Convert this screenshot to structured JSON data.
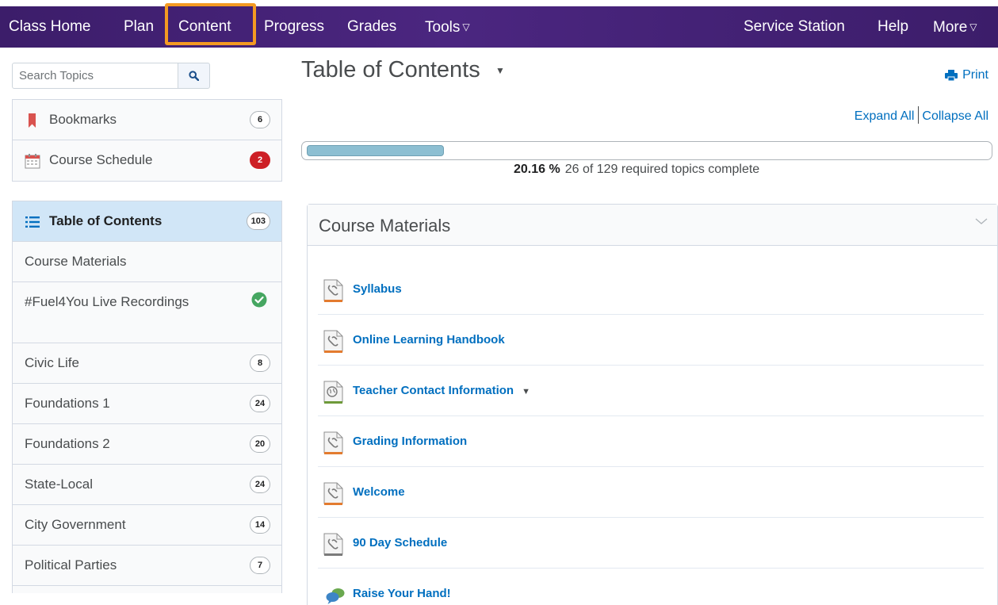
{
  "navbar": {
    "items": [
      {
        "label": "Class Home"
      },
      {
        "label": "Plan"
      },
      {
        "label": "Content"
      },
      {
        "label": "Progress"
      },
      {
        "label": "Grades"
      },
      {
        "label": "Tools"
      }
    ],
    "right_items": [
      {
        "label": "Service Station"
      },
      {
        "label": "Help"
      },
      {
        "label": "More"
      }
    ],
    "highlighted_item": "Content",
    "highlight_color": "#f49a22",
    "background_color": "#3d1e6d"
  },
  "sidebar": {
    "search": {
      "placeholder": "Search Topics",
      "icon": "search-icon"
    },
    "quick_links": [
      {
        "label": "Bookmarks",
        "count": "6",
        "icon": "bookmark-icon",
        "icon_color": "#d9534f"
      },
      {
        "label": "Course Schedule",
        "count": "2",
        "icon": "calendar-icon",
        "badge_color": "#cd2026"
      }
    ],
    "toc_header": {
      "label": "Table of Contents",
      "count": "103",
      "icon": "list-icon"
    },
    "modules": [
      {
        "label": "Course Materials",
        "count": ""
      },
      {
        "label": "#Fuel4You Live Recordings",
        "status": "completed",
        "icon": "check-circle-icon"
      },
      {
        "label": "Civic Life",
        "count": "8"
      },
      {
        "label": "Foundations 1",
        "count": "24"
      },
      {
        "label": "Foundations 2",
        "count": "20"
      },
      {
        "label": "State-Local",
        "count": "24"
      },
      {
        "label": "City Government",
        "count": "14"
      },
      {
        "label": "Political Parties",
        "count": "7"
      }
    ]
  },
  "main": {
    "title": "Table of Contents",
    "print_label": "Print",
    "expand_all_label": "Expand All",
    "collapse_all_label": "Collapse All",
    "progress": {
      "percent_text": "20.16 %",
      "percent_value": 0.2016,
      "summary": "26 of 129 required topics complete"
    },
    "section": {
      "title": "Course Materials",
      "topics": [
        {
          "label": "Syllabus",
          "icon": "link-document-icon"
        },
        {
          "label": "Online Learning Handbook",
          "icon": "link-document-icon"
        },
        {
          "label": "Teacher Contact Information",
          "icon": "web-page-icon",
          "has_menu": true
        },
        {
          "label": "Grading Information",
          "icon": "link-document-icon"
        },
        {
          "label": "Welcome",
          "icon": "link-document-icon"
        },
        {
          "label": "90 Day Schedule",
          "icon": "link-document-icon"
        },
        {
          "label": "Raise Your Hand!",
          "icon": "discussion-icon"
        }
      ]
    }
  }
}
